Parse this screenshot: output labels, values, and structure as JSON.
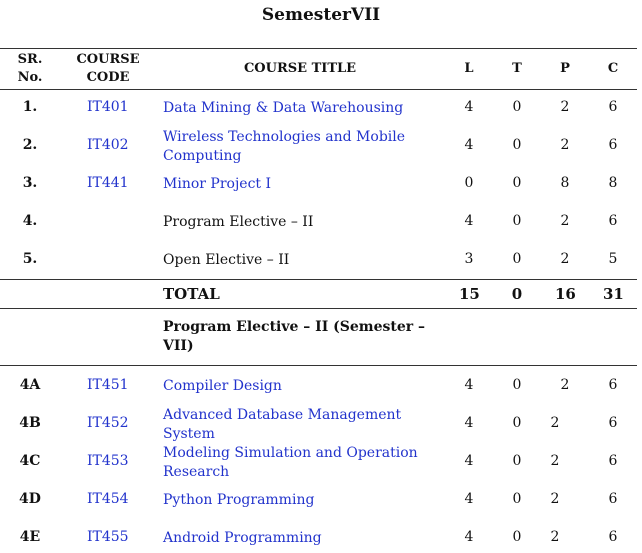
{
  "page": {
    "title": "SemesterVII"
  },
  "header": {
    "sr": [
      "SR.",
      "No."
    ],
    "code": [
      "COURSE",
      "CODE"
    ],
    "title": "COURSE TITLE",
    "l": "L",
    "t": "T",
    "p": "P",
    "c": "C"
  },
  "courses": [
    {
      "sr": "1.",
      "code": "IT401",
      "title": [
        "Data Mining & Data Warehousing"
      ],
      "l": "4",
      "t": "0",
      "p": "2",
      "c": "6"
    },
    {
      "sr": "2.",
      "code": "IT402",
      "title": [
        "Wireless Technologies and Mobile",
        "Computing"
      ],
      "l": "4",
      "t": "0",
      "p": "2",
      "c": "6"
    },
    {
      "sr": "3.",
      "code": "IT441",
      "title": [
        "Minor Project I"
      ],
      "l": "0",
      "t": "0",
      "p": "8",
      "c": "8"
    },
    {
      "sr": "4.",
      "code": "",
      "title": [
        "Program Elective – II"
      ],
      "l": "4",
      "t": "0",
      "p": "2",
      "c": "6"
    },
    {
      "sr": "5.",
      "code": "",
      "title": [
        "Open Elective – II"
      ],
      "l": "3",
      "t": "0",
      "p": "2",
      "c": "5"
    }
  ],
  "total": {
    "label": "TOTAL",
    "l": "15",
    "t": "0",
    "p": "16",
    "c": "31"
  },
  "elective_heading": [
    "Program Elective – II  (Semester –",
    "VII)"
  ],
  "electives": [
    {
      "sr": "4A",
      "code": "IT451",
      "title": [
        "Compiler Design"
      ],
      "l": "4",
      "t": "0",
      "p": "2",
      "c": "6"
    },
    {
      "sr": "4B",
      "code": "IT452",
      "title": [
        "Advanced Database Management",
        "System"
      ],
      "l": "4",
      "t": "0",
      "p": "2",
      "c": "6"
    },
    {
      "sr": "4C",
      "code": "IT453",
      "title": [
        "Modeling Simulation and Operation",
        "Research"
      ],
      "l": "4",
      "t": "0",
      "p": "2",
      "c": "6"
    },
    {
      "sr": "4D",
      "code": "IT454",
      "title": [
        "Python Programming"
      ],
      "l": "4",
      "t": "0",
      "p": "2",
      "c": "6"
    },
    {
      "sr": "4E",
      "code": "IT455",
      "title": [
        "Android Programming"
      ],
      "l": "4",
      "t": "0",
      "p": "2",
      "c": "6"
    }
  ],
  "colors": {
    "link": "#2233cc",
    "text": "#111111",
    "rule": "#333333"
  }
}
